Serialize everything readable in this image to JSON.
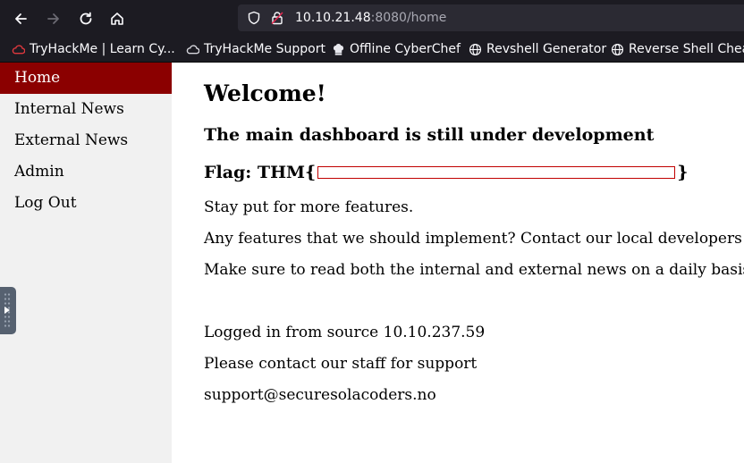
{
  "browser": {
    "url_host": "10.10.21.48",
    "url_rest": ":8080/home",
    "bookmarks": [
      {
        "label": "TryHackMe | Learn Cy...",
        "icon": "tryhackme-icon"
      },
      {
        "label": "TryHackMe Support",
        "icon": "support-icon"
      },
      {
        "label": "Offline CyberChef",
        "icon": "chef-hat-icon"
      },
      {
        "label": "Revshell Generator",
        "icon": "globe-icon"
      },
      {
        "label": "Reverse Shell Cheat",
        "icon": "globe-icon"
      }
    ]
  },
  "sidebar": {
    "items": [
      {
        "label": "Home",
        "active": true
      },
      {
        "label": "Internal News"
      },
      {
        "label": "External News"
      },
      {
        "label": "Admin"
      },
      {
        "label": "Log Out"
      }
    ]
  },
  "main": {
    "title": "Welcome!",
    "subtitle": "The main dashboard is still under development",
    "flag_prefix": "Flag: THM{",
    "flag_suffix": "}",
    "paragraphs": [
      "Stay put for more features.",
      "Any features that we should implement? Contact our local developers!",
      "Make sure to read both the internal and external news on a daily basis."
    ],
    "login_source": "Logged in from source 10.10.237.59",
    "contact": "Please contact our staff for support",
    "email": "support@securesolacoders.no"
  },
  "colors": {
    "accent": "#8b0000",
    "sidebar_bg": "#f1f1f1",
    "chrome_bg": "#1c1b22"
  }
}
